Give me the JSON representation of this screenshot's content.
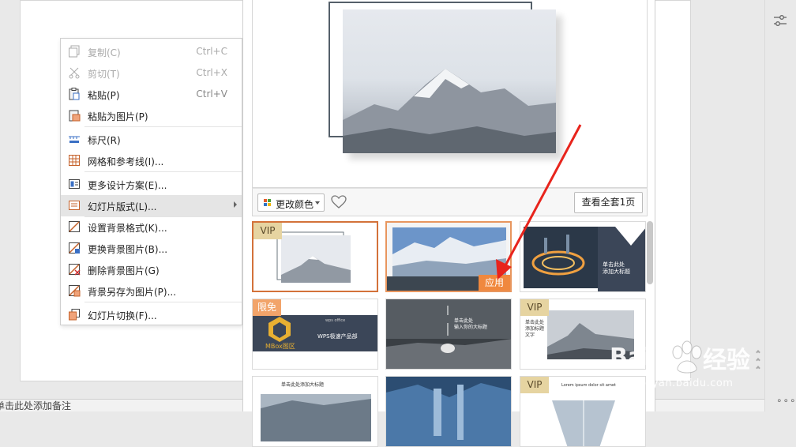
{
  "context_menu": {
    "items": [
      {
        "label": "复制(C)",
        "shortcut": "Ctrl+C",
        "icon": "copy-icon"
      },
      {
        "label": "剪切(T)",
        "shortcut": "Ctrl+X",
        "icon": "cut-icon"
      },
      {
        "label": "粘贴(P)",
        "shortcut": "Ctrl+V",
        "icon": "paste-icon"
      },
      {
        "label": "粘贴为图片(P)",
        "shortcut": "",
        "icon": "paste-as-image-icon"
      },
      {
        "label": "标尺(R)",
        "shortcut": "",
        "icon": "ruler-icon"
      },
      {
        "label": "网格和参考线(I)...",
        "shortcut": "",
        "icon": "grid-icon"
      },
      {
        "label": "更多设计方案(E)...",
        "shortcut": "",
        "icon": "design-icon"
      },
      {
        "label": "幻灯片版式(L)...",
        "shortcut": "",
        "icon": "layout-icon"
      },
      {
        "label": "设置背景格式(K)...",
        "shortcut": "",
        "icon": "background-format-icon"
      },
      {
        "label": "更换背景图片(B)...",
        "shortcut": "",
        "icon": "change-background-icon"
      },
      {
        "label": "删除背景图片(G)",
        "shortcut": "",
        "icon": "delete-background-icon"
      },
      {
        "label": "背景另存为图片(P)...",
        "shortcut": "",
        "icon": "save-background-icon"
      },
      {
        "label": "幻灯片切换(F)...",
        "shortcut": "",
        "icon": "transition-icon"
      }
    ]
  },
  "design_panel": {
    "change_color_label": "更改颜色",
    "view_all_label": "查看全套1页",
    "badge_vip": "VIP",
    "badge_free": "限免",
    "apply_label": "应用",
    "thumb_texts": {
      "t3": "单击此处\n添加大标题",
      "t4_line1": "MBox图区",
      "t4_line2": "WPS极速产品部",
      "t4_top": "wps office",
      "t5": "单击此处\n输入你的大标题",
      "t6": "单击此处\n添加标题\n文字",
      "t7": "单击此处添加大标题",
      "t9": "Lorem ipsum dolor sit amet"
    }
  },
  "notes_bar": {
    "text": "单击此处添加备注"
  },
  "status": {
    "more": "∘∘∘"
  },
  "watermark": {
    "brand": "Bai",
    "cn": "经验",
    "url": "jingyan.baidu.com"
  }
}
